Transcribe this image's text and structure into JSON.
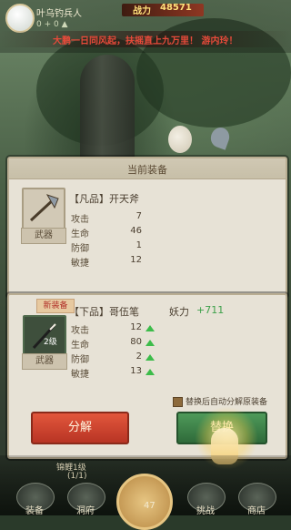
{
  "player": {
    "name": "叶乌钓兵人",
    "stat_line": "0 + 0 ▲"
  },
  "power": {
    "label": "战力",
    "value": "48571"
  },
  "banner": "大鹏一日同风起，扶摇直上九万里！ 游内玲！",
  "current_panel": {
    "title": "当前装备",
    "item": {
      "name": "【凡品】开天斧",
      "type": "武器"
    },
    "stats": [
      {
        "label": "攻击",
        "value": "7"
      },
      {
        "label": "生命",
        "value": "46"
      },
      {
        "label": "防御",
        "value": "1"
      },
      {
        "label": "敏捷",
        "value": "12"
      }
    ]
  },
  "new_panel": {
    "badge": "新装备",
    "item": {
      "name": "【下品】哥伍笔",
      "type": "武器",
      "level": "2级"
    },
    "yaoli_label": "妖力",
    "yaoli_value": "+711",
    "stats": [
      {
        "label": "攻击",
        "value": "12"
      },
      {
        "label": "生命",
        "value": "80"
      },
      {
        "label": "防御",
        "value": "2"
      },
      {
        "label": "敏捷",
        "value": "13"
      }
    ],
    "auto_decompose_label": "替换后自动分解原装备",
    "decompose_button": "分解",
    "replace_button": "替换"
  },
  "bottom": {
    "stage_label": "锦鲤1级",
    "stage_progress": "(1/1)",
    "nav": [
      "装备",
      "洞府",
      "",
      "挑战",
      "商店"
    ],
    "center_count": "47"
  },
  "colors": {
    "accent_green": "#3dbc4a",
    "accent_red": "#e64a3a",
    "gold": "#ffe07a"
  }
}
